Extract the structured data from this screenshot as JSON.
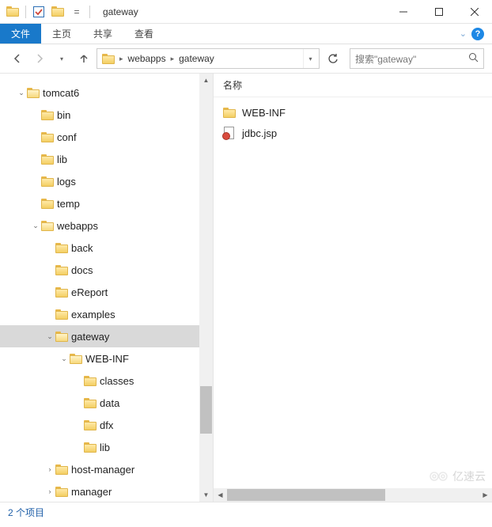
{
  "window": {
    "title": "gateway",
    "min_tip": "Minimize",
    "max_tip": "Maximize",
    "close_tip": "Close"
  },
  "ribbon": {
    "file": "文件",
    "home": "主页",
    "share": "共享",
    "view": "查看"
  },
  "address": {
    "crumbs": [
      "webapps",
      "gateway"
    ],
    "refresh": "Refresh"
  },
  "search": {
    "placeholder": "搜索\"gateway\""
  },
  "tree": [
    {
      "depth": 0,
      "label": "tomcat6",
      "expanded": true,
      "has_children": true
    },
    {
      "depth": 1,
      "label": "bin"
    },
    {
      "depth": 1,
      "label": "conf"
    },
    {
      "depth": 1,
      "label": "lib"
    },
    {
      "depth": 1,
      "label": "logs"
    },
    {
      "depth": 1,
      "label": "temp"
    },
    {
      "depth": 1,
      "label": "webapps",
      "expanded": true,
      "has_children": true
    },
    {
      "depth": 2,
      "label": "back"
    },
    {
      "depth": 2,
      "label": "docs"
    },
    {
      "depth": 2,
      "label": "eReport"
    },
    {
      "depth": 2,
      "label": "examples"
    },
    {
      "depth": 2,
      "label": "gateway",
      "selected": true,
      "expanded": true,
      "has_children": true
    },
    {
      "depth": 3,
      "label": "WEB-INF",
      "expanded": true,
      "has_children": true
    },
    {
      "depth": 4,
      "label": "classes"
    },
    {
      "depth": 4,
      "label": "data"
    },
    {
      "depth": 4,
      "label": "dfx"
    },
    {
      "depth": 4,
      "label": "lib"
    },
    {
      "depth": 2,
      "label": "host-manager",
      "has_children": true
    },
    {
      "depth": 2,
      "label": "manager",
      "has_children": true
    }
  ],
  "content": {
    "header_name": "名称",
    "items": [
      {
        "type": "folder",
        "name": "WEB-INF"
      },
      {
        "type": "jsp",
        "name": "jdbc.jsp"
      }
    ]
  },
  "status": {
    "count": "2 个项目"
  },
  "watermark": "亿速云"
}
